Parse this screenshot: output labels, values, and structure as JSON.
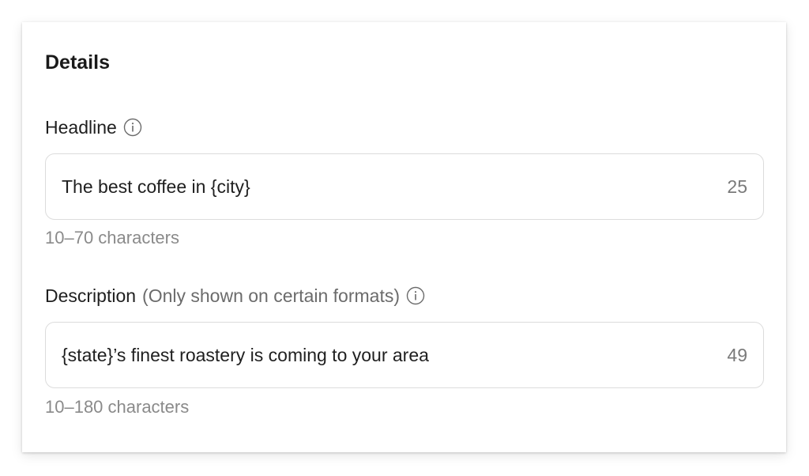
{
  "details": {
    "title": "Details",
    "headline": {
      "label": "Headline",
      "info_icon": "info-icon",
      "value": "The best coffee in {city}",
      "char_count": "25",
      "helper": "10–70 characters"
    },
    "description": {
      "label": "Description",
      "note": "(Only shown on certain formats)",
      "info_icon": "info-icon",
      "value": "{state}’s finest roastery is coming to your area",
      "char_count": "49",
      "helper": "10–180 characters"
    }
  },
  "colors": {
    "text_primary": "#1f1f1f",
    "text_secondary": "#6b6b6b",
    "border": "#dcdcdc"
  }
}
